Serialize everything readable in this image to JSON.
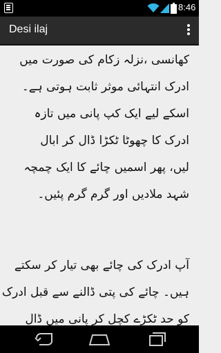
{
  "status_bar": {
    "time": "8:46",
    "icons": [
      "app-notification-icon",
      "wifi-icon",
      "signal-icon",
      "battery-icon"
    ]
  },
  "action_bar": {
    "title": "Desi ilaj",
    "menu_icon": "overflow-menu-icon"
  },
  "content": {
    "paragraph_1": [
      "کھانسی ،نزلہ زکام کی صورت میں",
      "ادرک انتہائی موثر ثابت ہوتی ہے۔",
      "اسکے لیے ایک کپ پانی میں تازہ",
      "ادرک کا چھوٹا ٹکڑا ڈال کر ابال",
      "لیں، پھر اسمیں چائے کا ایک چمچہ",
      "شہد ملادیں اور گرم گرم پئیں۔"
    ],
    "paragraph_2": [
      "آپ ادرک کی چائے بھی تیار کر سکتے",
      "ہیں۔ چائے کی پتی ڈالنے سے قبل ادرک",
      "کو حد ٹکڑے کچل کر پانی میں ڈال"
    ]
  },
  "nav_bar": {
    "buttons": [
      "back-icon",
      "home-icon",
      "recent-apps-icon"
    ]
  },
  "colors": {
    "status_bar": "#000000",
    "action_bar": "#2b2b2b",
    "content_bg": "#eeeeee",
    "text": "#111111",
    "wifi_signal_accent": "#33b5e5"
  }
}
